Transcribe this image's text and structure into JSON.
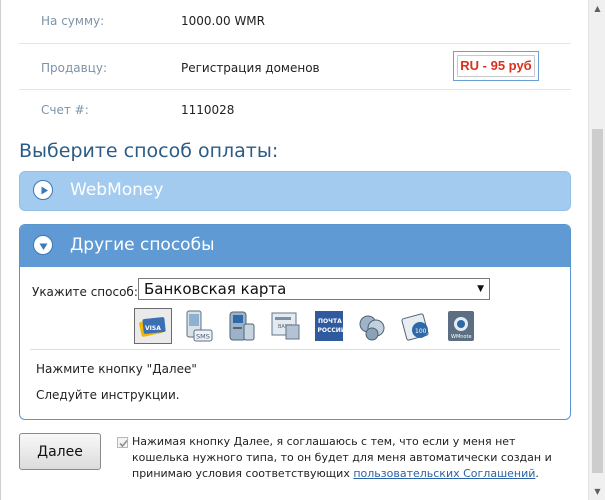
{
  "info": {
    "amount_label": "На сумму:",
    "amount_value": "1000.00 WMR",
    "seller_label": "Продавцу:",
    "seller_value": "Регистрация доменов",
    "seller_badge": "RU - 95 руб",
    "invoice_label": "Счет #:",
    "invoice_value": "1110028"
  },
  "payment": {
    "title": "Выберите способ оплаты:",
    "webmoney": {
      "label": "WebMoney",
      "expanded": false
    },
    "other": {
      "label": "Другие способы",
      "expanded": true,
      "method_label": "Укажите способ:",
      "method_selected": "Банковская карта",
      "method_icons": [
        "bank-card-icon",
        "sms-icon",
        "terminal-icon",
        "bank-transfer-icon",
        "russian-post-icon",
        "coins-icon",
        "wm-card-icon",
        "wmnote-icon"
      ],
      "hint_1": "Нажмите кнопку \"Далее\"",
      "hint_2": "Следуйте инструкции."
    }
  },
  "footer": {
    "next_label": "Далее",
    "agree_checked": true,
    "agree_text": "Нажимая кнопку Далее, я соглашаюсь с тем, что если у меня нет кошелька нужного типа, то он будет для меня автоматически создан и принимаю условия соответствующих ",
    "agree_link": "пользовательских Соглашений",
    "agree_end": "."
  },
  "colors": {
    "accent": "#5f9ad4",
    "accent_light": "#a2cbef",
    "title": "#2c5c86",
    "badge_text": "#d9301c",
    "link": "#2a62a8"
  }
}
